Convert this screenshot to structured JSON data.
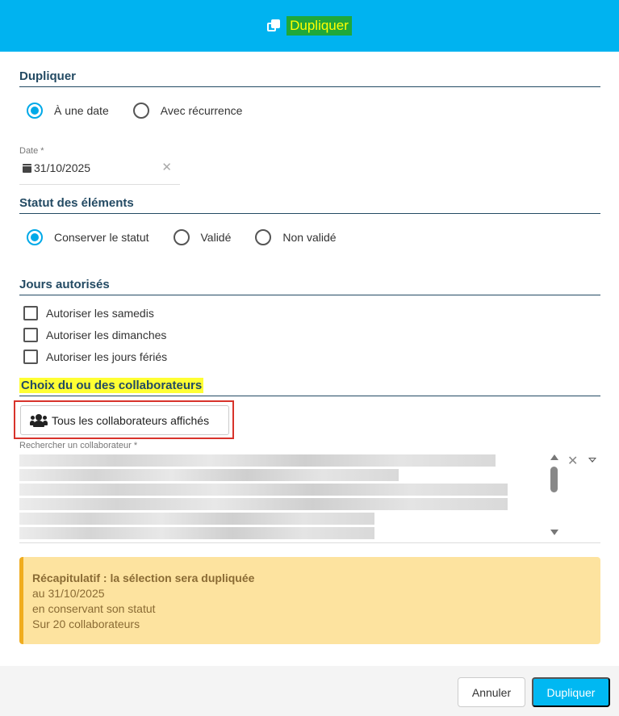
{
  "header": {
    "title": "Dupliquer",
    "icon": "copy-icon"
  },
  "sections": {
    "duplicate": {
      "title": "Dupliquer",
      "options": [
        {
          "label": "À une date",
          "checked": true
        },
        {
          "label": "Avec récurrence",
          "checked": false
        }
      ],
      "date_label": "Date *",
      "date_value": "31/10/2025"
    },
    "status": {
      "title": "Statut des éléments",
      "options": [
        {
          "label": "Conserver le statut",
          "checked": true
        },
        {
          "label": "Validé",
          "checked": false
        },
        {
          "label": "Non validé",
          "checked": false
        }
      ]
    },
    "days": {
      "title": "Jours autorisés",
      "checkboxes": [
        {
          "label": "Autoriser les samedis",
          "checked": false
        },
        {
          "label": "Autoriser les dimanches",
          "checked": false
        },
        {
          "label": "Autoriser les jours fériés",
          "checked": false
        }
      ]
    },
    "collaborators": {
      "title": "Choix du ou des collaborateurs",
      "all_button": "Tous les collaborateurs affichés",
      "search_label": "Rechercher un collaborateur *"
    }
  },
  "summary": {
    "head": "Récapitulatif : la sélection sera dupliquée",
    "line1": "au 31/10/2025",
    "line2": "en conservant son statut",
    "line3": "Sur 20 collaborateurs"
  },
  "footer": {
    "cancel": "Annuler",
    "confirm": "Dupliquer"
  },
  "colors": {
    "accent": "#00b3f0",
    "section": "#234a63",
    "summary_bg": "#fde39f"
  }
}
